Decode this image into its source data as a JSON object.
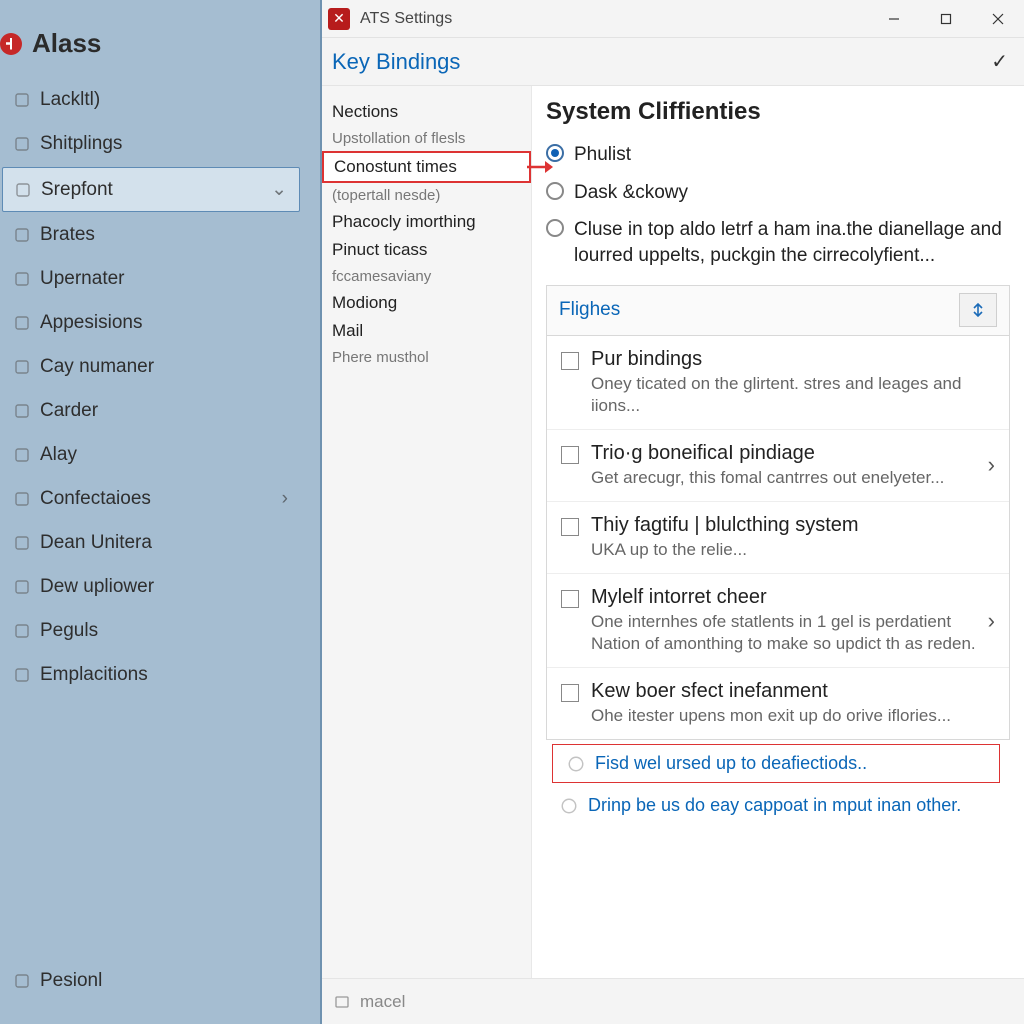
{
  "brand": {
    "title": "Alass"
  },
  "left_nav": {
    "items": [
      {
        "label": "Lackltl)"
      },
      {
        "label": "Shitplings"
      },
      {
        "label": "Srepfont",
        "selected": true,
        "dropdown": true
      },
      {
        "label": "Brates"
      },
      {
        "label": "Upernater"
      },
      {
        "label": "Appesisions"
      },
      {
        "label": "Cay numaner"
      },
      {
        "label": "Carder"
      },
      {
        "label": "Alay"
      },
      {
        "label": "Confectaioes",
        "chevron": true
      },
      {
        "label": "Dean Unitera"
      },
      {
        "label": "Dew upliower"
      },
      {
        "label": "Peguls"
      },
      {
        "label": "Emplacitions"
      }
    ],
    "bottom": "Pesionl"
  },
  "window": {
    "title": "ATS Settings"
  },
  "header": {
    "title": "Key Bindings"
  },
  "subnav": {
    "items": [
      {
        "label": "Nections"
      },
      {
        "label": "Upstollation of flesls",
        "sub": true
      },
      {
        "label": "Conostunt times",
        "highlight": true
      },
      {
        "label": "(topertall nesde)",
        "sub": true
      },
      {
        "label": "Phacocly imorthing"
      },
      {
        "label": "Pinuct ticass"
      },
      {
        "label": "fccamesaviany",
        "sub": true
      },
      {
        "label": "Modiong"
      },
      {
        "label": "Mail"
      },
      {
        "label": "Phere musthol",
        "sub": true
      }
    ]
  },
  "main": {
    "section_title": "System Cliffienties",
    "radios": [
      {
        "label": "Phulist",
        "checked": true
      },
      {
        "label": "Dask &ckowy",
        "checked": false
      },
      {
        "label": "Cluse in top aldo letrf a ham ina.the dianellage and lourred uppelts, puckgin the cirrecolyfient...",
        "checked": false
      }
    ],
    "list_header": "Flighes",
    "rows": [
      {
        "title": "Pur bindings",
        "desc": "Oney ticated on the glirtent. stres and leages and iions..."
      },
      {
        "title": "Trio·g boneificaI pindiage",
        "desc": "Get arecugr, this fomal cantrres out enelyeter...",
        "chevron": true
      },
      {
        "title": "Thiy fagtifu | blulcthing system",
        "desc": "UKA up to the relie..."
      },
      {
        "title": "Mylelf intorret cheer",
        "desc": "One internhes ofe statlents in 1 gel is perdatient Nation of amonthing to make so updict th as reden.",
        "chevron": true
      },
      {
        "title": "Kew boer sfect inefanment",
        "desc": "Ohe itester upens mon exit up do orive iflories..."
      }
    ],
    "links": [
      {
        "label": "Fisd wel ursed up to deafiectiods..",
        "boxed": true
      },
      {
        "label": "Drinp be us do eay cappoat in mput inan other."
      }
    ]
  },
  "statusbar": {
    "label": "macel"
  }
}
